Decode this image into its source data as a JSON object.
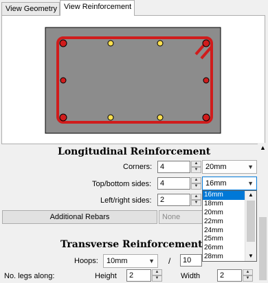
{
  "tabs": [
    {
      "label": "View Geometry"
    },
    {
      "label": "View Reinforcement"
    }
  ],
  "longitudinal": {
    "heading": "Longitudinal Reinforcement",
    "corners_label": "Corners:",
    "corners_value": "4",
    "corners_size": "20mm",
    "top_bottom_label": "Top/bottom sides:",
    "top_bottom_value": "4",
    "top_bottom_size": "16mm",
    "left_right_label": "Left/right sides:",
    "left_right_value": "2",
    "additional_label": "Additional Rebars",
    "additional_value": "None"
  },
  "size_options": [
    "16mm",
    "18mm",
    "20mm",
    "22mm",
    "24mm",
    "25mm",
    "26mm",
    "28mm"
  ],
  "selected_option": "16mm",
  "transverse": {
    "heading": "Transverse Reinforcement",
    "hoops_label": "Hoops:",
    "hoops_size": "10mm",
    "slash": "/",
    "spacing": "10",
    "legs_label": "No. legs along:",
    "height_label": "Height",
    "height_value": "2",
    "width_label": "Width",
    "width_value": "2"
  },
  "colors": {
    "concrete": "#8c8c8c",
    "rebar": "#d01c1c",
    "corner_bar": "#d01c1c",
    "side_bar": "#ffe050"
  }
}
